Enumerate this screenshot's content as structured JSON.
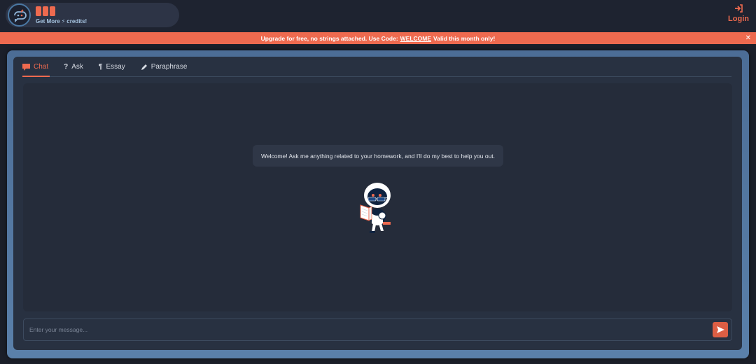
{
  "header": {
    "credits_count": 3,
    "get_more_prefix": "Get More",
    "get_more_suffix": "credits!",
    "login_label": "Login"
  },
  "banner": {
    "text_before": "Upgrade for free, no strings attached. Use Code:",
    "code": "WELCOME",
    "text_after": "Valid this month only!",
    "close_glyph": "✕"
  },
  "tabs": [
    {
      "label": "Chat",
      "icon": "chat-bubble-icon",
      "active": true
    },
    {
      "label": "Ask",
      "icon": "question-icon",
      "active": false
    },
    {
      "label": "Essay",
      "icon": "paragraph-icon",
      "active": false
    },
    {
      "label": "Paraphrase",
      "icon": "pencil-icon",
      "active": false
    }
  ],
  "chat": {
    "welcome_message": "Welcome! Ask me anything related to your homework, and I'll do my best to help you out."
  },
  "input": {
    "placeholder": "Enter your message...",
    "value": ""
  },
  "colors": {
    "accent": "#ee6a4f",
    "background": "#1b1f29",
    "panel": "#283141",
    "frame": "#5a80aa"
  }
}
